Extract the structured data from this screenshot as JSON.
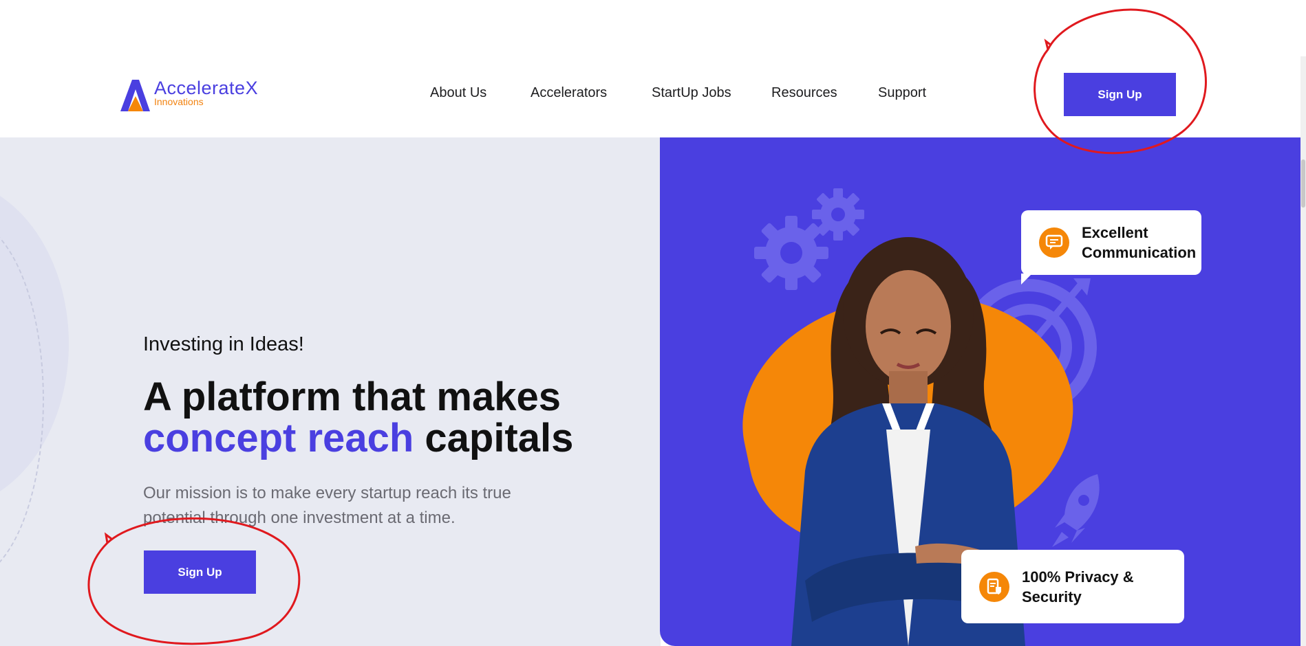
{
  "brand": {
    "name": "AccelerateX",
    "tagline": "Innovations",
    "colors": {
      "primary": "#4a3fe0",
      "accent": "#f58708",
      "annotation": "#e0191e"
    }
  },
  "nav": {
    "items": [
      {
        "label": "About Us"
      },
      {
        "label": "Accelerators"
      },
      {
        "label": "StartUp Jobs"
      },
      {
        "label": "Resources"
      },
      {
        "label": "Support"
      }
    ]
  },
  "header": {
    "signup_label": "Sign Up"
  },
  "hero": {
    "kicker": "Investing in Ideas!",
    "headline_line1": "A platform that makes",
    "headline_accent": "concept reach",
    "headline_rest": " capitals",
    "mission": "Our mission is to make every startup reach its true potential through one investment at a time.",
    "signup_label": "Sign Up"
  },
  "features": {
    "communication": "Excellent Communication",
    "privacy": "100% Privacy & Security"
  },
  "icons": [
    "logo-a-icon",
    "gear-icon",
    "target-icon",
    "rocket-icon",
    "chat-icon",
    "document-shield-icon"
  ]
}
